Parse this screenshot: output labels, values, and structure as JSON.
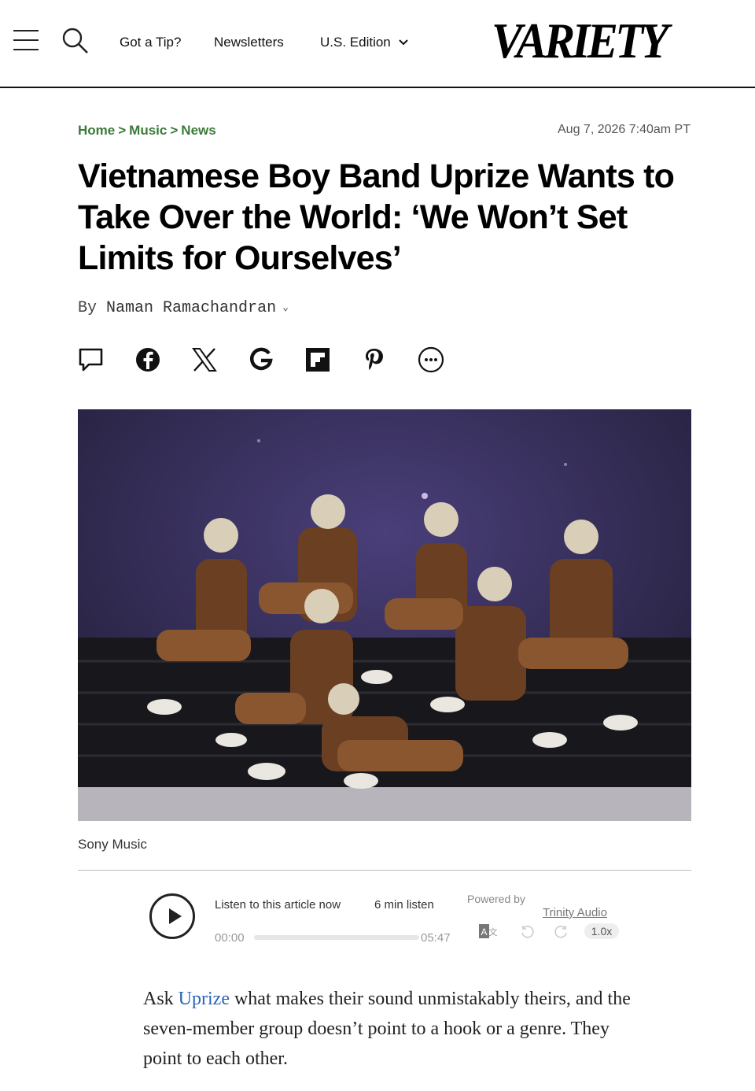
{
  "header": {
    "nav": [
      "Got a Tip?",
      "Newsletters",
      "U.S. Edition"
    ],
    "logo": "VARIETY"
  },
  "breadcrumb": [
    "Home",
    "Music",
    "News"
  ],
  "breadcrumb_sep": ">",
  "date": "Aug 7, 2026 7:40am PT",
  "headline": "Vietnamese Boy Band Uprize Wants to Take Over the World: ‘We Won’t Set Limits for Ourselves’",
  "byline": {
    "prefix": "By",
    "author": "Naman Ramachandran"
  },
  "share_icons": [
    "comment-icon",
    "facebook-icon",
    "x-icon",
    "google-icon",
    "flipboard-icon",
    "pinterest-icon",
    "more-icon"
  ],
  "image": {
    "caption": "Sony Music"
  },
  "player": {
    "listen_label": "Listen to this article now",
    "duration_label": "6 min listen",
    "time_start": "00:00",
    "time_end": "05:47",
    "progress": 0,
    "powered_by": "Powered by",
    "provider": "Trinity Audio",
    "speed": "1.0x"
  },
  "body": {
    "pre": "Ask ",
    "link": "Uprize",
    "post": " what makes their sound unmistakably theirs, and the seven-member group doesn’t point to a hook or a genre. They point to each other."
  },
  "colors": {
    "breadcrumb": "#3a7a3a",
    "link": "#2a63b8"
  }
}
